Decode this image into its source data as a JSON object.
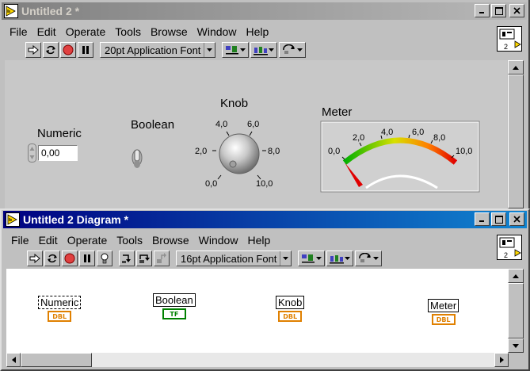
{
  "front_panel": {
    "title": "Untitled 2 *",
    "menu": [
      "File",
      "Edit",
      "Operate",
      "Tools",
      "Browse",
      "Window",
      "Help"
    ],
    "font_selector": "20pt Application Font",
    "icon_label": "2",
    "controls": {
      "numeric": {
        "label": "Numeric",
        "value": "0,00"
      },
      "boolean": {
        "label": "Boolean"
      },
      "knob": {
        "label": "Knob",
        "ticks": [
          "0,0",
          "2,0",
          "4,0",
          "6,0",
          "8,0",
          "10,0"
        ]
      },
      "meter": {
        "label": "Meter",
        "ticks": [
          "0,0",
          "2,0",
          "4,0",
          "6,0",
          "8,0",
          "10,0"
        ]
      }
    }
  },
  "diagram": {
    "title": "Untitled 2 Diagram *",
    "menu": [
      "File",
      "Edit",
      "Operate",
      "Tools",
      "Browse",
      "Window",
      "Help"
    ],
    "font_selector": "16pt Application Font",
    "icon_label": "2",
    "nodes": [
      {
        "label": "Numeric",
        "type": "DBL"
      },
      {
        "label": "Boolean",
        "type": "TF"
      },
      {
        "label": "Knob",
        "type": "DBL"
      },
      {
        "label": "Meter",
        "type": "DBL"
      }
    ]
  },
  "colors": {
    "active_title": "#000080",
    "inactive_title": "#808080",
    "dbl_terminal": "#e08000",
    "bool_terminal": "#008000"
  }
}
